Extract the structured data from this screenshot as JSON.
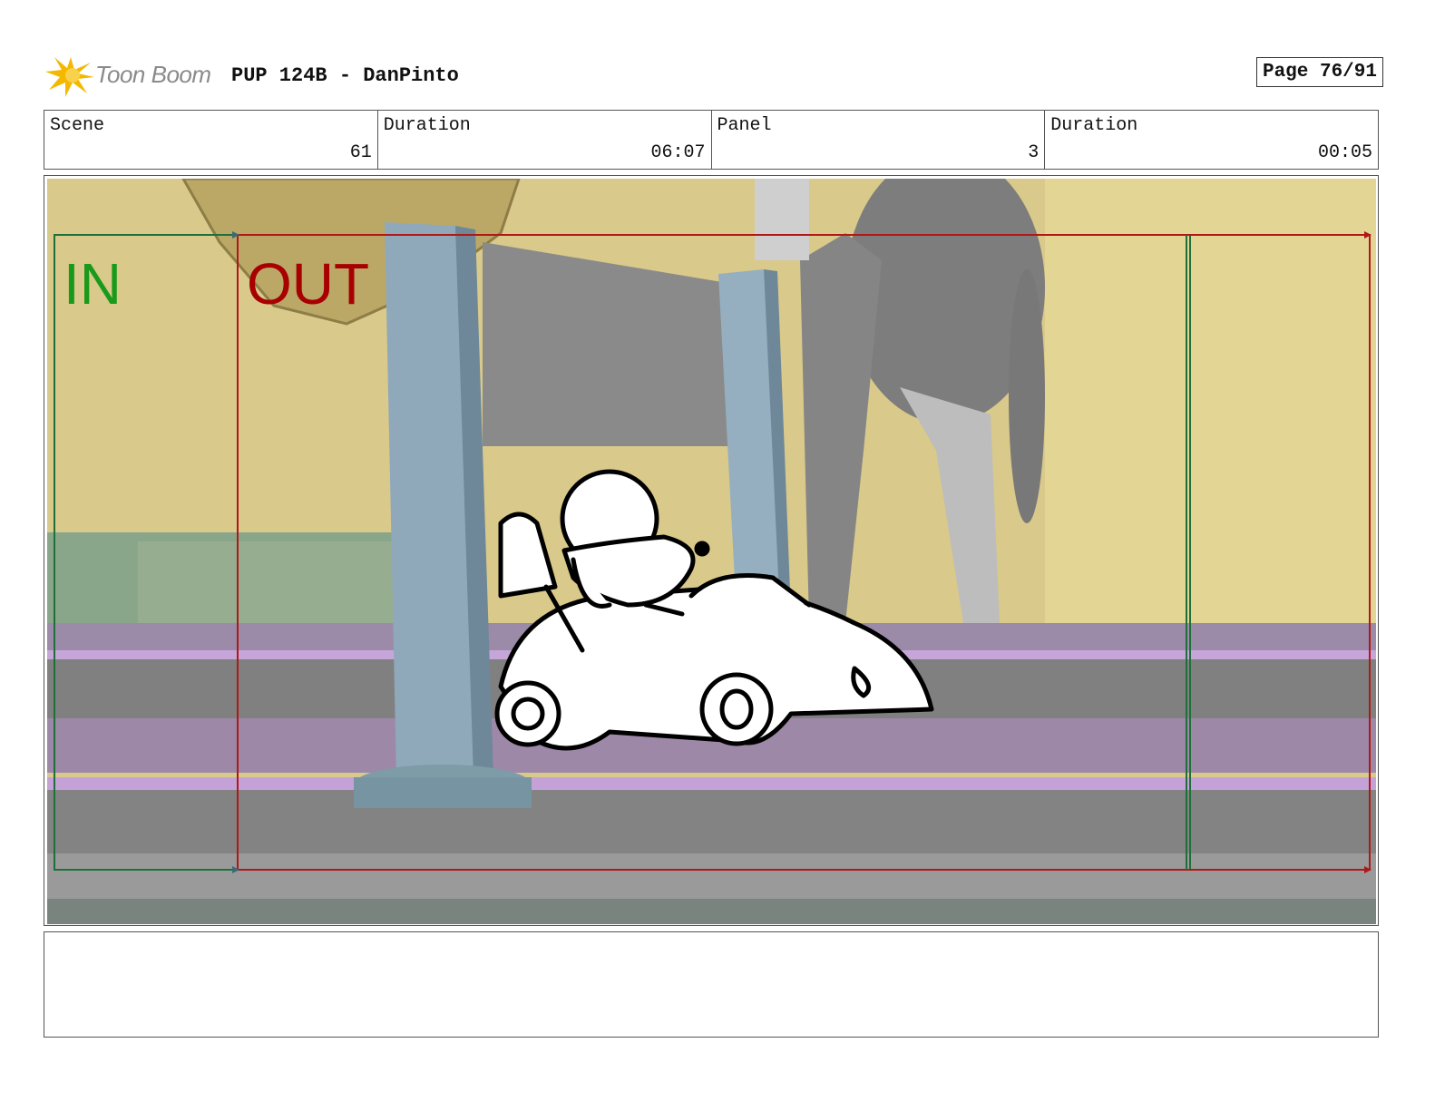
{
  "header": {
    "logo_text": "Toon Boom",
    "title": "PUP 124B - DanPinto",
    "page": "Page 76/91"
  },
  "info": {
    "scene_label": "Scene",
    "scene_value": "61",
    "scene_duration_label": "Duration",
    "scene_duration_value": "06:07",
    "panel_label": "Panel",
    "panel_value": "3",
    "panel_duration_label": "Duration",
    "panel_duration_value": "00:05"
  },
  "panel_image": {
    "in_label": "IN",
    "out_label": "OUT",
    "in_color": "#1a9a1a",
    "out_color": "#a80000"
  },
  "notes": {
    "text": ""
  }
}
